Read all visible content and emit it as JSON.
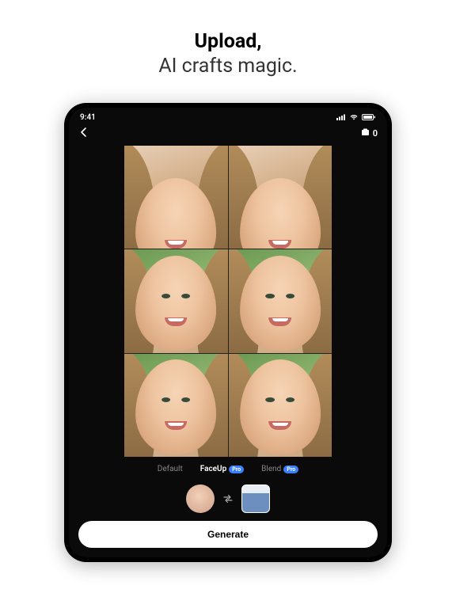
{
  "headline": {
    "bold": "Upload,",
    "sub": "AI crafts magic."
  },
  "status": {
    "time": "9:41"
  },
  "nav": {
    "credits": "0"
  },
  "tabs": [
    {
      "label": "Default",
      "active": false,
      "badge": null
    },
    {
      "label": "FaceUp",
      "active": true,
      "badge": "Pro"
    },
    {
      "label": "Blend",
      "active": false,
      "badge": "Pro"
    }
  ],
  "actions": {
    "generate": "Generate"
  }
}
